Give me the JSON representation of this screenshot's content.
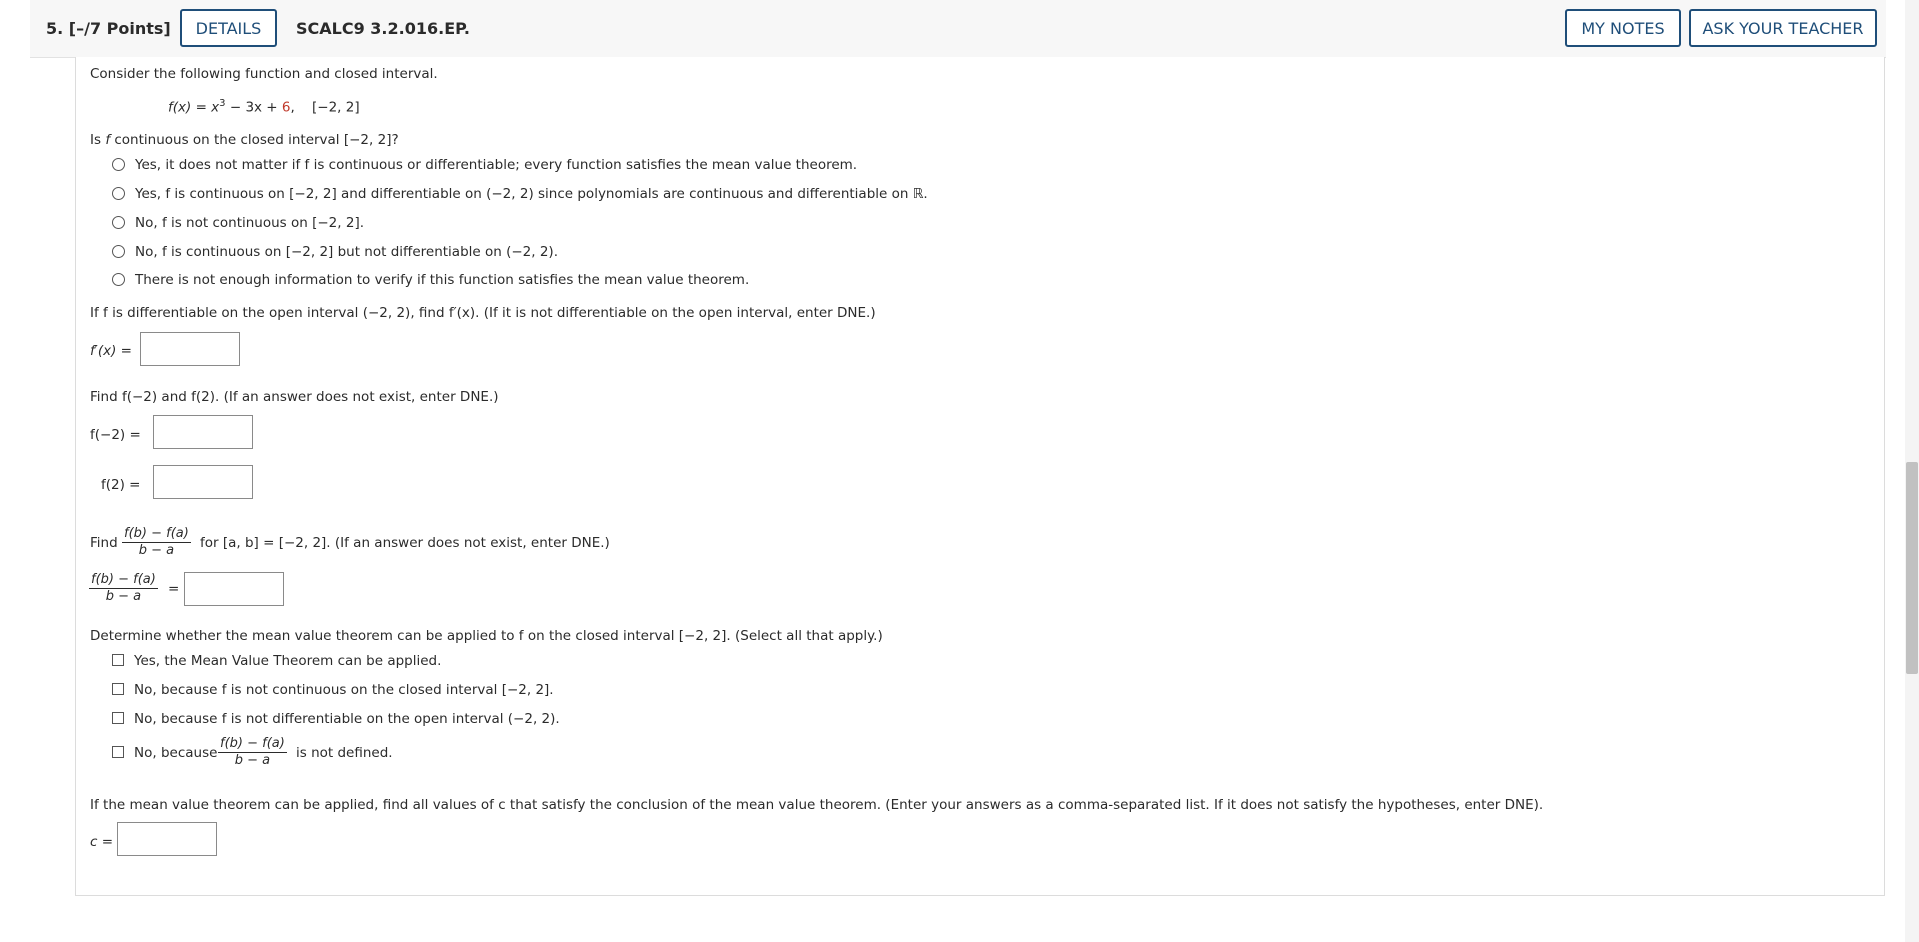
{
  "header": {
    "question_label": "5.  [–/7 Points]",
    "details_button": "DETAILS",
    "question_id": "SCALC9 3.2.016.EP.",
    "my_notes_button": "MY NOTES",
    "ask_teacher_button": "ASK YOUR TEACHER"
  },
  "intro": "Consider the following function and closed interval.",
  "function": {
    "lhs": "f(x) = x",
    "exp": "3",
    "mid": " − 3x + ",
    "const": "6",
    "tail": ",",
    "interval": "[−2, 2]"
  },
  "q1": {
    "prompt_a": "Is ",
    "prompt_f": "f",
    "prompt_b": " continuous on the closed interval [−2, 2]?",
    "options": [
      "Yes, it does not matter if f is continuous or differentiable; every function satisfies the mean value theorem.",
      "Yes, f is continuous on [−2, 2] and differentiable on (−2, 2) since polynomials are continuous and differentiable on ℝ.",
      "No, f is not continuous on [−2, 2].",
      "No, f is continuous on [−2, 2] but not differentiable on (−2, 2).",
      "There is not enough information to verify if this function satisfies the mean value theorem."
    ]
  },
  "q2": {
    "prompt": "If f is differentiable on the open interval (−2, 2), find f′(x). (If it is not differentiable on the open interval, enter DNE.)",
    "label": "f′(x) =",
    "value": ""
  },
  "q3": {
    "prompt": "Find f(−2) and f(2). (If an answer does not exist, enter DNE.)",
    "label_a": "f(−2)  =",
    "label_b": "f(2)  =",
    "value_a": "",
    "value_b": ""
  },
  "q4": {
    "prompt_a": "Find",
    "num": "f(b) − f(a)",
    "den": "b − a",
    "prompt_b": "for [a, b] = [−2, 2]. (If an answer does not exist, enter DNE.)",
    "label_eq": "=",
    "value": ""
  },
  "q5": {
    "prompt": "Determine whether the mean value theorem can be applied to f on the closed interval [−2, 2]. (Select all that apply.)",
    "options": [
      "Yes, the Mean Value Theorem can be applied.",
      "No, because f is not continuous on the closed interval [−2, 2].",
      "No, because f is not differentiable on the open interval (−2, 2)."
    ],
    "last_option_a": "No, because",
    "last_option_num": "f(b) − f(a)",
    "last_option_den": "b − a",
    "last_option_b": "is not defined."
  },
  "q6": {
    "prompt": "If the mean value theorem can be applied, find all values of c that satisfy the conclusion of the mean value theorem. (Enter your answers as a comma-separated list. If it does not satisfy the hypotheses, enter DNE).",
    "label": "c =",
    "value": ""
  },
  "colors": {
    "accent": "#1f4e79",
    "highlight": "#c0392b"
  }
}
